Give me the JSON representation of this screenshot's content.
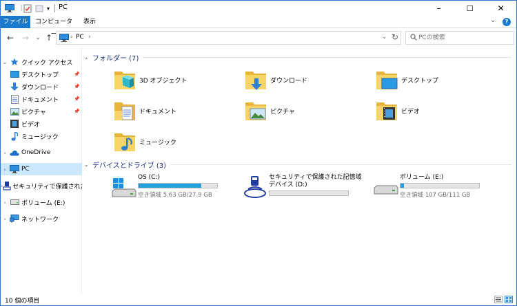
{
  "window": {
    "title": "PC",
    "controls": {
      "minimize": "–",
      "maximize": "☐",
      "close": "✕"
    }
  },
  "ribbon": {
    "tabs": [
      {
        "label": "ファイル"
      },
      {
        "label": "コンピューター"
      },
      {
        "label": "表示"
      }
    ],
    "expand": "⌄",
    "help": "?"
  },
  "address": {
    "segments": [
      "PC",
      "›"
    ],
    "dropdown": "⌄",
    "refresh": "↻"
  },
  "search": {
    "placeholder": "PCの検索"
  },
  "navpane": {
    "quick_access": "クイック アクセス",
    "quick_items": [
      {
        "label": "デスクトップ"
      },
      {
        "label": "ダウンロード"
      },
      {
        "label": "ドキュメント"
      },
      {
        "label": "ピクチャ"
      },
      {
        "label": "ビデオ"
      },
      {
        "label": "ミュージック"
      }
    ],
    "onedrive": "OneDrive",
    "pc": "PC",
    "secure": "セキュリティで保護された",
    "volume": "ボリューム (E:)",
    "network": "ネットワーク"
  },
  "folders": {
    "heading": "フォルダー (7)",
    "items": [
      {
        "label": "3D オブジェクト"
      },
      {
        "label": "ダウンロード"
      },
      {
        "label": "デスクトップ"
      },
      {
        "label": "ドキュメント"
      },
      {
        "label": "ピクチャ"
      },
      {
        "label": "ビデオ"
      },
      {
        "label": "ミュージック"
      }
    ]
  },
  "drives": {
    "heading": "デバイスとドライブ (3)",
    "items": [
      {
        "name": "OS (C:)",
        "name2": "",
        "free": "空き領域 5.63 GB/27.9 GB",
        "used_fraction": 0.8
      },
      {
        "name": "セキュリティで保護された記憶域",
        "name2": "デバイス (D:)",
        "free": "",
        "used_fraction": 0
      },
      {
        "name": "ボリューム (E:)",
        "name2": "",
        "free": "空き領域 107 GB/111 GB",
        "used_fraction": 0.04
      }
    ]
  },
  "status": {
    "count": "10 個の項目"
  },
  "colors": {
    "accent": "#1979ca",
    "selection": "#cce8ff",
    "bar_fill": "#26a0da",
    "folder": "#f3c84c"
  }
}
